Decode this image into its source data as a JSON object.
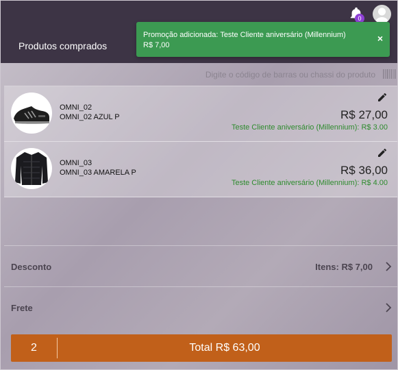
{
  "header": {
    "title": "Produtos comprados",
    "notification_count": "0"
  },
  "toast": {
    "line1": "Promoção adicionada: Teste Cliente aniversário (Millennium)",
    "line2": "R$ 7,00",
    "close_label": "×"
  },
  "barcode": {
    "placeholder": "Digite o código de barras ou chassi do produto"
  },
  "items": [
    {
      "code": "OMNI_02",
      "description": "OMNI_02 AZUL P",
      "price": "R$ 27,00",
      "promotion": "Teste Cliente aniversário (Millennium): R$ 3.00",
      "image": "sneaker"
    },
    {
      "code": "OMNI_03",
      "description": "OMNI_03 AMARELA P",
      "price": "R$ 36,00",
      "promotion": "Teste Cliente aniversário (Millennium): R$ 4.00",
      "image": "jacket"
    }
  ],
  "summary": {
    "discount_label": "Desconto",
    "discount_value": "Itens: R$ 7,00",
    "shipping_label": "Frete"
  },
  "footer": {
    "quantity": "2",
    "total": "Total R$ 63,00"
  },
  "colors": {
    "header_bg": "#3d3445",
    "toast_bg": "#3c9a52",
    "promo_text": "#2e8b2e",
    "total_bar": "#c1601a",
    "badge": "#8e3fd6"
  },
  "icons": [
    "bell-icon",
    "user-avatar-icon",
    "close-icon",
    "barcode-icon",
    "pencil-icon",
    "chevron-right-icon"
  ]
}
